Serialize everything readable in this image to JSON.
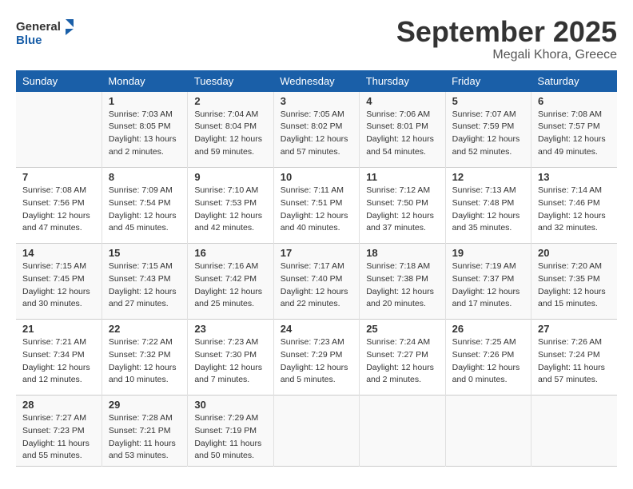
{
  "header": {
    "logo_general": "General",
    "logo_blue": "Blue",
    "month_title": "September 2025",
    "location": "Megali Khora, Greece"
  },
  "days_of_week": [
    "Sunday",
    "Monday",
    "Tuesday",
    "Wednesday",
    "Thursday",
    "Friday",
    "Saturday"
  ],
  "weeks": [
    [
      {
        "day": "",
        "info": ""
      },
      {
        "day": "1",
        "info": "Sunrise: 7:03 AM\nSunset: 8:05 PM\nDaylight: 13 hours\nand 2 minutes."
      },
      {
        "day": "2",
        "info": "Sunrise: 7:04 AM\nSunset: 8:04 PM\nDaylight: 12 hours\nand 59 minutes."
      },
      {
        "day": "3",
        "info": "Sunrise: 7:05 AM\nSunset: 8:02 PM\nDaylight: 12 hours\nand 57 minutes."
      },
      {
        "day": "4",
        "info": "Sunrise: 7:06 AM\nSunset: 8:01 PM\nDaylight: 12 hours\nand 54 minutes."
      },
      {
        "day": "5",
        "info": "Sunrise: 7:07 AM\nSunset: 7:59 PM\nDaylight: 12 hours\nand 52 minutes."
      },
      {
        "day": "6",
        "info": "Sunrise: 7:08 AM\nSunset: 7:57 PM\nDaylight: 12 hours\nand 49 minutes."
      }
    ],
    [
      {
        "day": "7",
        "info": "Sunrise: 7:08 AM\nSunset: 7:56 PM\nDaylight: 12 hours\nand 47 minutes."
      },
      {
        "day": "8",
        "info": "Sunrise: 7:09 AM\nSunset: 7:54 PM\nDaylight: 12 hours\nand 45 minutes."
      },
      {
        "day": "9",
        "info": "Sunrise: 7:10 AM\nSunset: 7:53 PM\nDaylight: 12 hours\nand 42 minutes."
      },
      {
        "day": "10",
        "info": "Sunrise: 7:11 AM\nSunset: 7:51 PM\nDaylight: 12 hours\nand 40 minutes."
      },
      {
        "day": "11",
        "info": "Sunrise: 7:12 AM\nSunset: 7:50 PM\nDaylight: 12 hours\nand 37 minutes."
      },
      {
        "day": "12",
        "info": "Sunrise: 7:13 AM\nSunset: 7:48 PM\nDaylight: 12 hours\nand 35 minutes."
      },
      {
        "day": "13",
        "info": "Sunrise: 7:14 AM\nSunset: 7:46 PM\nDaylight: 12 hours\nand 32 minutes."
      }
    ],
    [
      {
        "day": "14",
        "info": "Sunrise: 7:15 AM\nSunset: 7:45 PM\nDaylight: 12 hours\nand 30 minutes."
      },
      {
        "day": "15",
        "info": "Sunrise: 7:15 AM\nSunset: 7:43 PM\nDaylight: 12 hours\nand 27 minutes."
      },
      {
        "day": "16",
        "info": "Sunrise: 7:16 AM\nSunset: 7:42 PM\nDaylight: 12 hours\nand 25 minutes."
      },
      {
        "day": "17",
        "info": "Sunrise: 7:17 AM\nSunset: 7:40 PM\nDaylight: 12 hours\nand 22 minutes."
      },
      {
        "day": "18",
        "info": "Sunrise: 7:18 AM\nSunset: 7:38 PM\nDaylight: 12 hours\nand 20 minutes."
      },
      {
        "day": "19",
        "info": "Sunrise: 7:19 AM\nSunset: 7:37 PM\nDaylight: 12 hours\nand 17 minutes."
      },
      {
        "day": "20",
        "info": "Sunrise: 7:20 AM\nSunset: 7:35 PM\nDaylight: 12 hours\nand 15 minutes."
      }
    ],
    [
      {
        "day": "21",
        "info": "Sunrise: 7:21 AM\nSunset: 7:34 PM\nDaylight: 12 hours\nand 12 minutes."
      },
      {
        "day": "22",
        "info": "Sunrise: 7:22 AM\nSunset: 7:32 PM\nDaylight: 12 hours\nand 10 minutes."
      },
      {
        "day": "23",
        "info": "Sunrise: 7:23 AM\nSunset: 7:30 PM\nDaylight: 12 hours\nand 7 minutes."
      },
      {
        "day": "24",
        "info": "Sunrise: 7:23 AM\nSunset: 7:29 PM\nDaylight: 12 hours\nand 5 minutes."
      },
      {
        "day": "25",
        "info": "Sunrise: 7:24 AM\nSunset: 7:27 PM\nDaylight: 12 hours\nand 2 minutes."
      },
      {
        "day": "26",
        "info": "Sunrise: 7:25 AM\nSunset: 7:26 PM\nDaylight: 12 hours\nand 0 minutes."
      },
      {
        "day": "27",
        "info": "Sunrise: 7:26 AM\nSunset: 7:24 PM\nDaylight: 11 hours\nand 57 minutes."
      }
    ],
    [
      {
        "day": "28",
        "info": "Sunrise: 7:27 AM\nSunset: 7:23 PM\nDaylight: 11 hours\nand 55 minutes."
      },
      {
        "day": "29",
        "info": "Sunrise: 7:28 AM\nSunset: 7:21 PM\nDaylight: 11 hours\nand 53 minutes."
      },
      {
        "day": "30",
        "info": "Sunrise: 7:29 AM\nSunset: 7:19 PM\nDaylight: 11 hours\nand 50 minutes."
      },
      {
        "day": "",
        "info": ""
      },
      {
        "day": "",
        "info": ""
      },
      {
        "day": "",
        "info": ""
      },
      {
        "day": "",
        "info": ""
      }
    ]
  ]
}
